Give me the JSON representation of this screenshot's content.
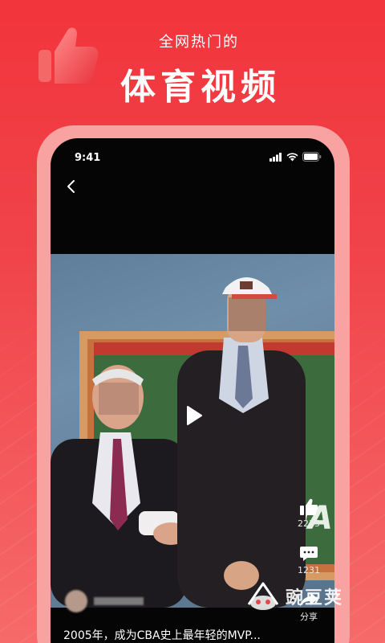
{
  "header": {
    "subtitle": "全网热门的",
    "title": "体育视频"
  },
  "status_bar": {
    "time": "9:41"
  },
  "video": {
    "board_text": "NA",
    "caption": "2005年，成为CBA史上最年轻的MVP..."
  },
  "actions": {
    "like_count": "2235",
    "comment_count": "1231",
    "share_label": "分享"
  },
  "watermark": {
    "text": "豌豆荚"
  },
  "colors": {
    "background": "#f0444a",
    "phone_frame": "#f9a2a2",
    "screen": "#050505"
  }
}
